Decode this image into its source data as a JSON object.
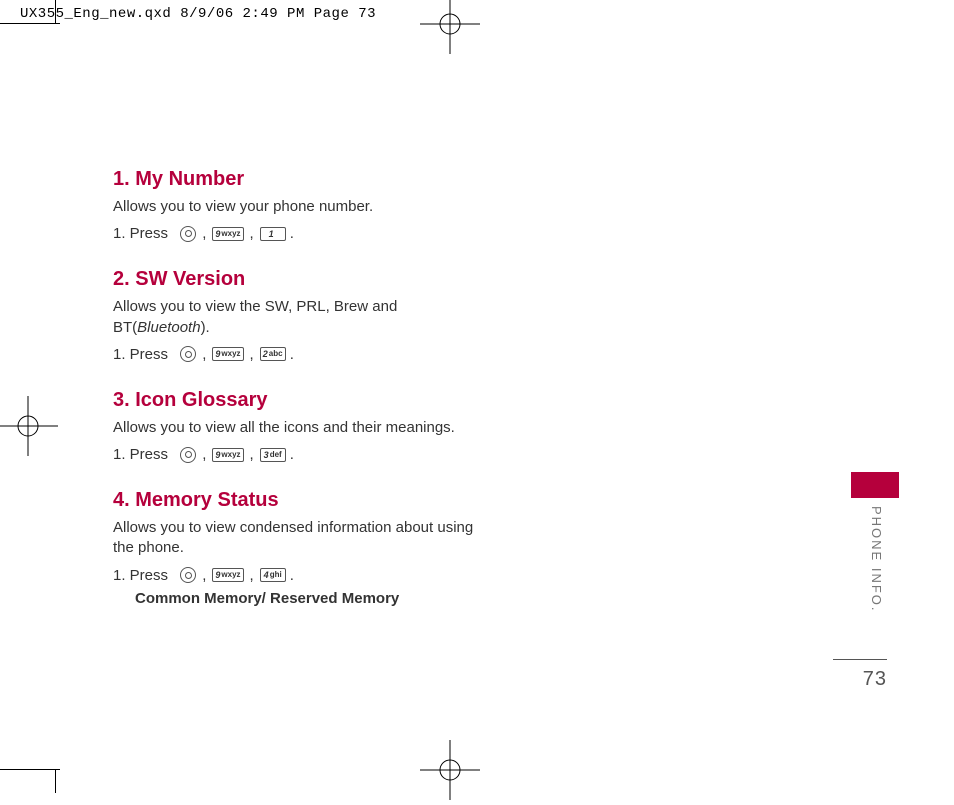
{
  "slug": "UX355_Eng_new.qxd  8/9/06  2:49 PM  Page 73",
  "page_number": "73",
  "side_tab": "PHONE INFO.",
  "keys": {
    "ok": "OK",
    "k9": "9 wxyz",
    "k1": "1",
    "k2": "2 abc",
    "k3": "3 def",
    "k4": "4 ghi"
  },
  "sections": [
    {
      "heading": "1. My Number",
      "desc": "Allows you to view your phone number.",
      "step_prefix": "1. Press",
      "seq": [
        "ok",
        "k9",
        "k1"
      ],
      "sub": ""
    },
    {
      "heading": "2. SW Version",
      "desc_plain_a": "Allows you to view the SW, PRL, Brew and BT(",
      "desc_em": "Bluetooth",
      "desc_plain_b": ").",
      "step_prefix": "1. Press",
      "seq": [
        "ok",
        "k9",
        "k2"
      ],
      "sub": ""
    },
    {
      "heading": "3. Icon Glossary",
      "desc": "Allows you to view all the icons and their meanings.",
      "step_prefix": "1. Press",
      "seq": [
        "ok",
        "k9",
        "k3"
      ],
      "sub": ""
    },
    {
      "heading": "4. Memory Status",
      "desc": "Allows you to view condensed information about using the phone.",
      "step_prefix": "1. Press",
      "seq": [
        "ok",
        "k9",
        "k4"
      ],
      "sub": "Common Memory/ Reserved Memory"
    }
  ]
}
